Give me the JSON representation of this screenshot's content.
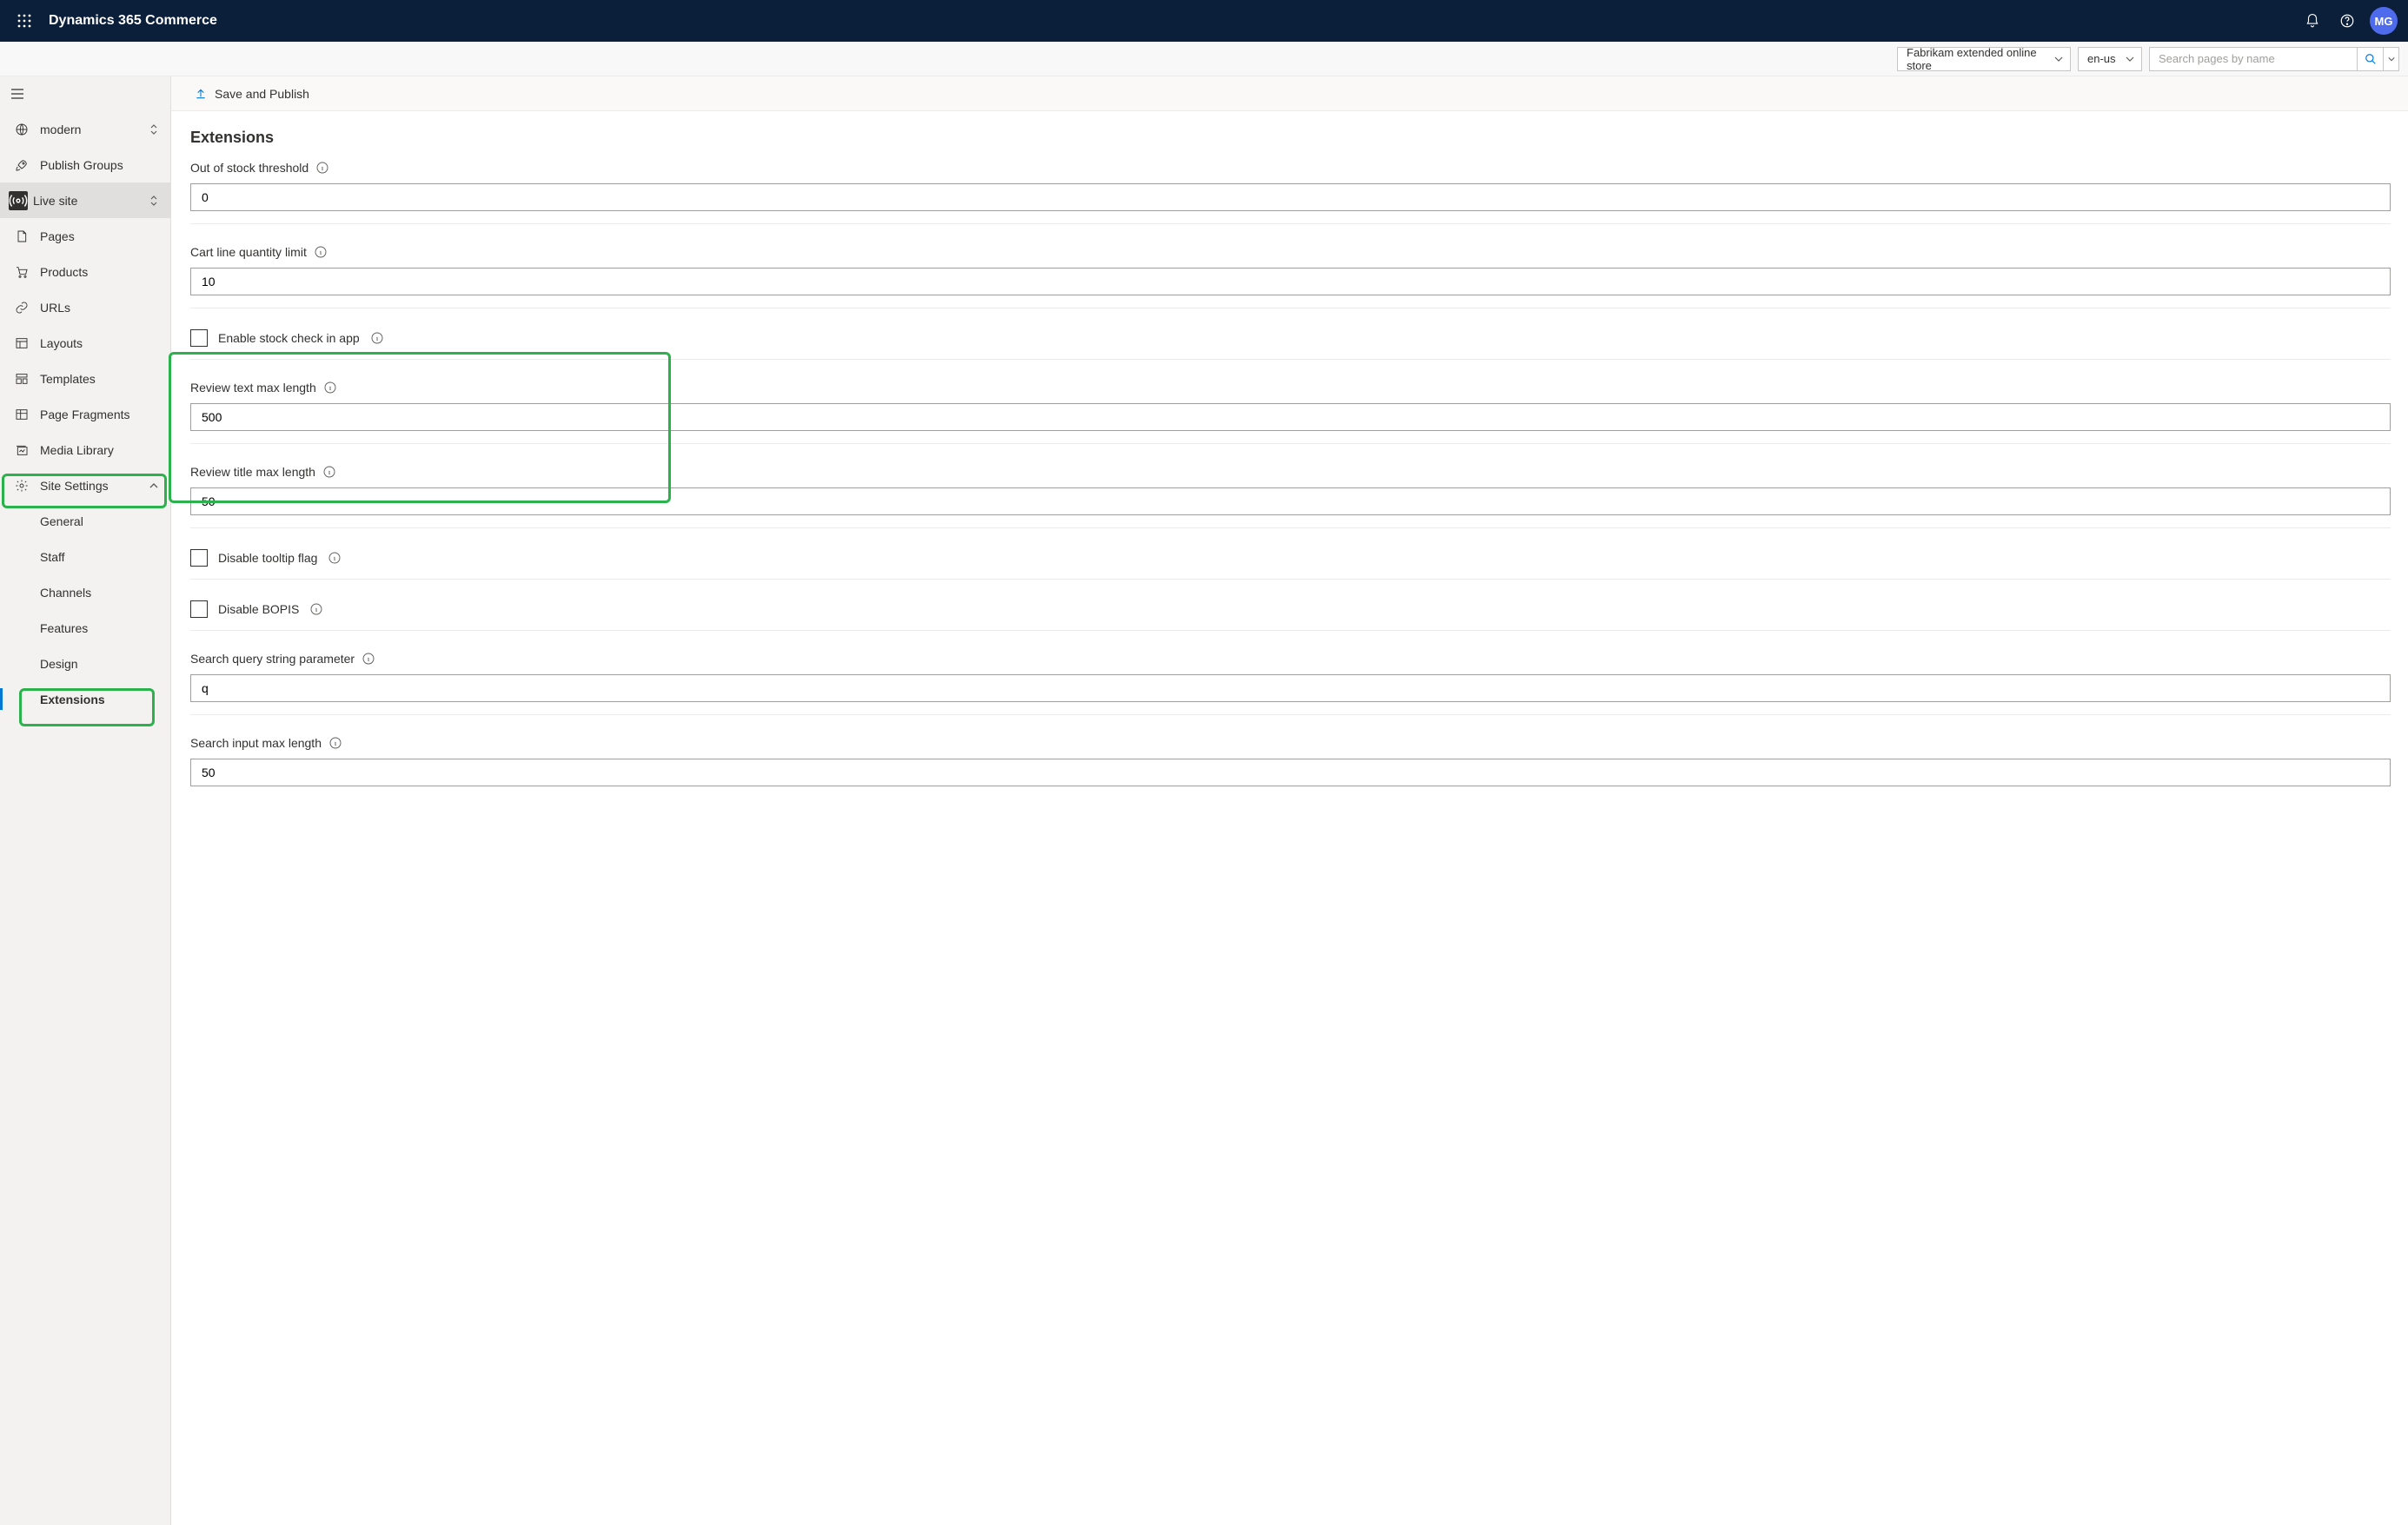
{
  "header": {
    "product_name": "Dynamics 365 Commerce",
    "avatar_initials": "MG"
  },
  "sub_header": {
    "store_name": "Fabrikam extended online store",
    "locale": "en-us",
    "search_placeholder": "Search pages by name"
  },
  "sidebar": {
    "items": [
      {
        "id": "modern",
        "label": "modern",
        "icon": "globe",
        "tail": "sort"
      },
      {
        "id": "publish-groups",
        "label": "Publish Groups",
        "icon": "rocket"
      },
      {
        "id": "live-site",
        "label": "Live site",
        "icon": "broadcast",
        "active": true,
        "tail": "sort"
      },
      {
        "id": "pages",
        "label": "Pages",
        "icon": "page"
      },
      {
        "id": "products",
        "label": "Products",
        "icon": "cart"
      },
      {
        "id": "urls",
        "label": "URLs",
        "icon": "link"
      },
      {
        "id": "layouts",
        "label": "Layouts",
        "icon": "layout"
      },
      {
        "id": "templates",
        "label": "Templates",
        "icon": "template"
      },
      {
        "id": "page-fragments",
        "label": "Page Fragments",
        "icon": "fragment"
      },
      {
        "id": "media-library",
        "label": "Media Library",
        "icon": "media"
      },
      {
        "id": "site-settings",
        "label": "Site Settings",
        "icon": "gear",
        "tail": "chev-up"
      }
    ],
    "sub_items": [
      {
        "id": "general",
        "label": "General"
      },
      {
        "id": "staff",
        "label": "Staff"
      },
      {
        "id": "channels",
        "label": "Channels"
      },
      {
        "id": "features",
        "label": "Features"
      },
      {
        "id": "design",
        "label": "Design"
      },
      {
        "id": "extensions",
        "label": "Extensions",
        "selected": true
      }
    ]
  },
  "commands": {
    "save_publish": "Save and Publish"
  },
  "page": {
    "title": "Extensions",
    "fields": {
      "out_of_stock_threshold": {
        "label": "Out of stock threshold",
        "value": "0"
      },
      "cart_line_qty_limit": {
        "label": "Cart line quantity limit",
        "value": "10"
      },
      "enable_stock_check": {
        "label": "Enable stock check in app",
        "checked": false
      },
      "review_text_max": {
        "label": "Review text max length",
        "value": "500"
      },
      "review_title_max": {
        "label": "Review title max length",
        "value": "50"
      },
      "disable_tooltip": {
        "label": "Disable tooltip flag",
        "checked": false
      },
      "disable_bopis": {
        "label": "Disable BOPIS",
        "checked": false
      },
      "search_query_param": {
        "label": "Search query string parameter",
        "value": "q"
      },
      "search_input_max": {
        "label": "Search input max length",
        "value": "50"
      }
    }
  }
}
